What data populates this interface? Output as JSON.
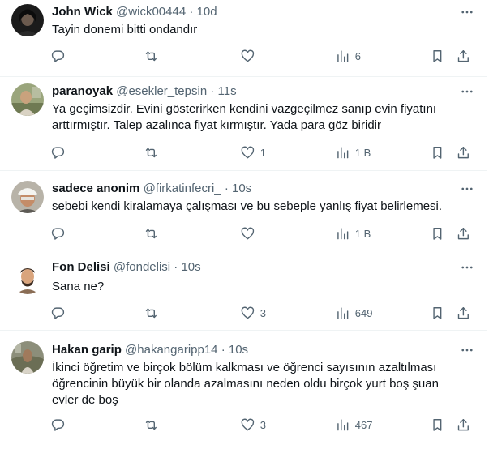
{
  "tweets": [
    {
      "name": "John Wick",
      "handle": "@wick00444",
      "sep": "·",
      "time": "10d",
      "text": "Tayin donemi bitti ondandır",
      "replies": "",
      "retweets": "",
      "likes": "",
      "views": "6",
      "avatar": "dark-portrait-avatar"
    },
    {
      "name": "paranoyak",
      "handle": "@esekler_tepsin",
      "sep": "·",
      "time": "11s",
      "text": "Ya geçimsizdir. Evini gösterirken kendini vazgeçilmez sanıp evin fiyatını arttırmıştır. Talep azalınca fiyat kırmıştır. Yada para göz biridir",
      "replies": "",
      "retweets": "",
      "likes": "1",
      "views": "1 B",
      "avatar": "outdoor-portrait-avatar"
    },
    {
      "name": "sadece anonim",
      "handle": "@firkatinfecri_",
      "sep": "·",
      "time": "10s",
      "text": "sebebi kendi kiralamaya çalışması ve bu sebeple yanlış fiyat belirlemesi.",
      "replies": "",
      "retweets": "",
      "likes": "",
      "views": "1 B",
      "avatar": "white-hat-avatar"
    },
    {
      "name": "Fon Delisi",
      "handle": "@fondelisi",
      "sep": "·",
      "time": "10s",
      "text": "Sana ne?",
      "replies": "",
      "retweets": "",
      "likes": "3",
      "views": "649",
      "avatar": "cartoon-avatar"
    },
    {
      "name": "Hakan garip",
      "handle": "@hakangaripp14",
      "sep": "·",
      "time": "10s",
      "text": "İkinci öğretim ve birçok bölüm kalkması ve öğrenci sayısının azaltılması öğrencinin büyük bir olanda azalmasını neden oldu birçok yurt boş şuan evler de boş",
      "replies": "",
      "retweets": "",
      "likes": "3",
      "views": "467",
      "avatar": "landscape-avatar"
    }
  ],
  "icons": {
    "reply": "reply-icon",
    "retweet": "retweet-icon",
    "like": "heart-icon",
    "views": "views-chart-icon",
    "bookmark": "bookmark-icon",
    "share": "share-icon",
    "more": "more-options-icon"
  },
  "colors": {
    "text": "#0f1419",
    "secondary": "#536471",
    "border": "#eff3f4"
  }
}
